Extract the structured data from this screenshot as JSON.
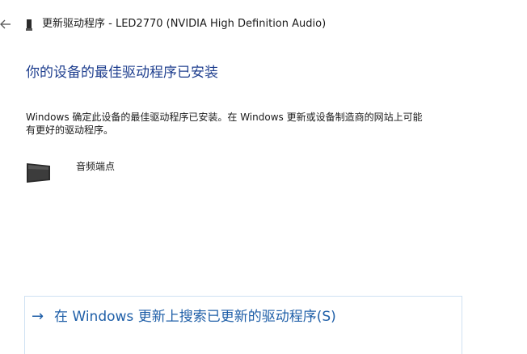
{
  "window": {
    "title": "更新驱动程序 - LED2770 (NVIDIA High Definition Audio)"
  },
  "main": {
    "heading": "你的设备的最佳驱动程序已安装",
    "description_line1": "Windows 确定此设备的最佳驱动程序已安装。在 Windows 更新或设备制造商的网站上可能",
    "description_line2": "有更好的驱动程序。",
    "device_name": "音频端点",
    "search_link": {
      "arrow": "→",
      "label": "在 Windows 更新上搜索已更新的驱动程序(S)"
    }
  },
  "icons": {
    "back": "back-arrow-icon",
    "device": "device-icon",
    "monitor": "monitor-icon"
  },
  "colors": {
    "heading": "#1f3f8f",
    "link": "#1f5fa8",
    "link_border": "#cfe1f3"
  }
}
